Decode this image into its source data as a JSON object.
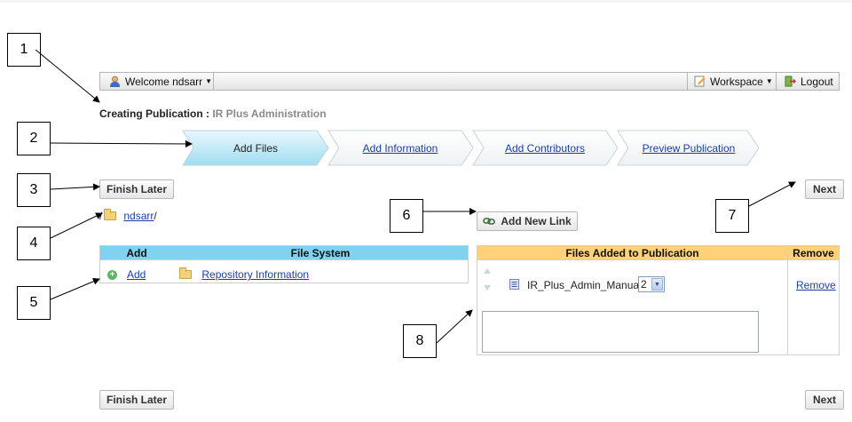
{
  "callouts": [
    "1",
    "2",
    "3",
    "4",
    "5",
    "6",
    "7",
    "8"
  ],
  "topbar": {
    "welcome": "Welcome ndsarr",
    "workspace": "Workspace",
    "logout": "Logout"
  },
  "heading": {
    "label": "Creating Publication : ",
    "name": "IR Plus Administration"
  },
  "steps": [
    "Add Files",
    "Add Information",
    "Add Contributors",
    "Preview Publication"
  ],
  "buttons": {
    "finish_later": "Finish Later",
    "next": "Next",
    "add_new_link": "Add New Link"
  },
  "path": {
    "prefix": "/",
    "folder": "ndsarr",
    "suffix": "/"
  },
  "file_system_table": {
    "headers": [
      "Add",
      "File System"
    ],
    "row": {
      "add": "Add",
      "item": "Repository Information"
    }
  },
  "files_added_table": {
    "headers": [
      "Files Added to Publication",
      "Remove"
    ],
    "file": {
      "name": "IR_Plus_Admin_Manual",
      "version": "2",
      "remove": "Remove"
    },
    "description_value": ""
  },
  "colors": {
    "file_system_header": "#80d2ee",
    "files_added_header": "#ffd27a",
    "link": "#1a3ea8",
    "active_step": "#bde8f5"
  },
  "icons": [
    "user-icon",
    "caret-down-icon",
    "workspace-icon",
    "logout-icon",
    "folder-icon",
    "add-circle-icon",
    "link-icon",
    "sort-up-icon",
    "sort-down-icon",
    "file-icon"
  ]
}
